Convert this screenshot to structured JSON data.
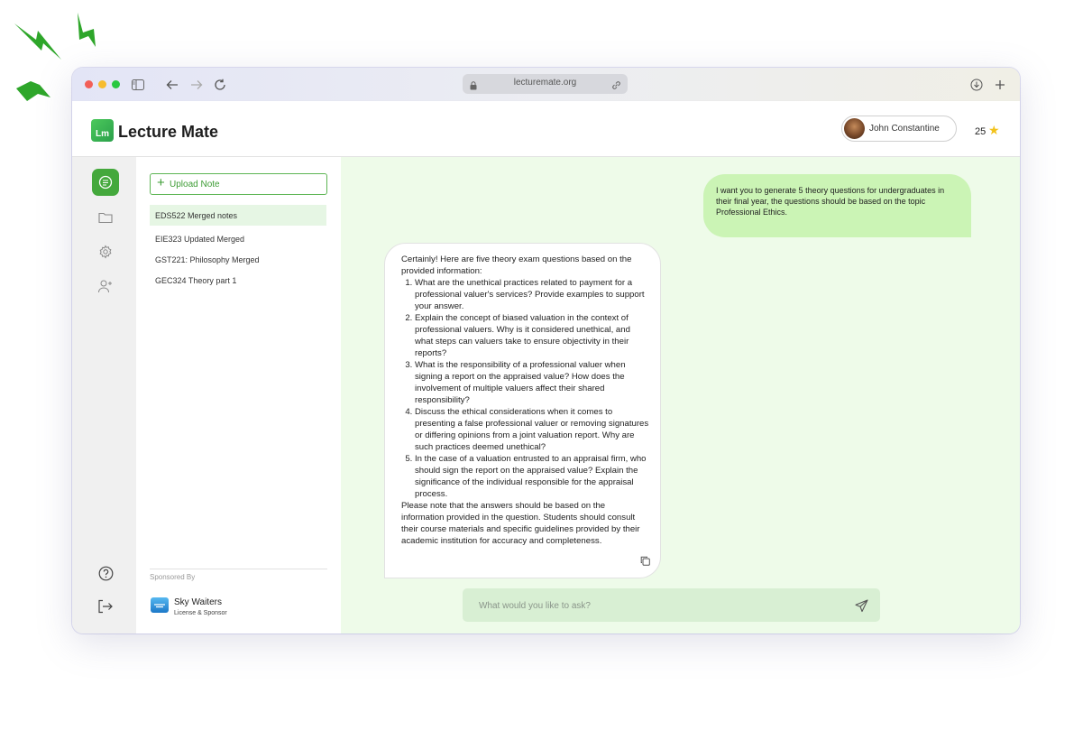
{
  "browser": {
    "url": "lecturemate.org",
    "icons": [
      "sidebar-toggle-icon",
      "back-arrow-icon",
      "forward-arrow-icon",
      "reload-icon",
      "lock-icon",
      "link-icon",
      "download-icon",
      "new-tab-plus-icon"
    ]
  },
  "app": {
    "logo_mark": "Lm",
    "title": "Lecture Mate"
  },
  "user": {
    "name": "John Constantine",
    "points": "25"
  },
  "rail": {
    "items": [
      "chat-icon",
      "folder-icon",
      "settings-gear-icon",
      "add-user-icon"
    ],
    "bottom": [
      "help-icon",
      "logout-icon"
    ]
  },
  "notes": {
    "upload_label": "Upload Note",
    "items": [
      {
        "label": "EDS522 Merged notes",
        "active": true
      },
      {
        "label": "EIE323 Updated Merged",
        "active": false
      },
      {
        "label": "GST221: Philosophy Merged",
        "active": false
      },
      {
        "label": "GEC324 Theory part 1",
        "active": false
      }
    ],
    "sponsor_label": "Sponsored By",
    "sponsor_name": "Sky Waiters",
    "sponsor_sub": "License & Sponsor"
  },
  "chat": {
    "user_message": "I want you to generate 5 theory questions for undergraduates in their final year, the questions should be based on the topic Professional Ethics.",
    "bot_intro": "Certainly! Here are five theory exam questions based on the provided information:",
    "bot_questions": [
      "What are the unethical practices related to payment for a professional valuer's services? Provide examples to support your answer.",
      "Explain the concept of biased valuation in the context of professional valuers. Why is it considered unethical, and what steps can valuers take to ensure objectivity in their reports?",
      "What is the responsibility of a professional valuer when signing a report on the appraised value? How does the involvement of multiple valuers affect their shared responsibility?",
      "Discuss the ethical considerations when it comes to presenting a false professional valuer or removing signatures or differing opinions from a joint valuation report. Why are such practices deemed unethical?",
      "In the case of a valuation entrusted to an appraisal firm, who should sign the report on the appraised value? Explain the significance of the individual responsible for the appraisal process."
    ],
    "bot_outro": "Please note that the answers should be based on the information provided in the question. Students should consult their course materials and specific guidelines provided by their academic institution for accuracy and completeness.",
    "input_placeholder": "What would you like to ask?"
  },
  "colors": {
    "brand_green": "#44a83c",
    "user_bubble": "#cbf4b5",
    "chat_bg": "#eefbe9",
    "star": "#f2c21b"
  }
}
